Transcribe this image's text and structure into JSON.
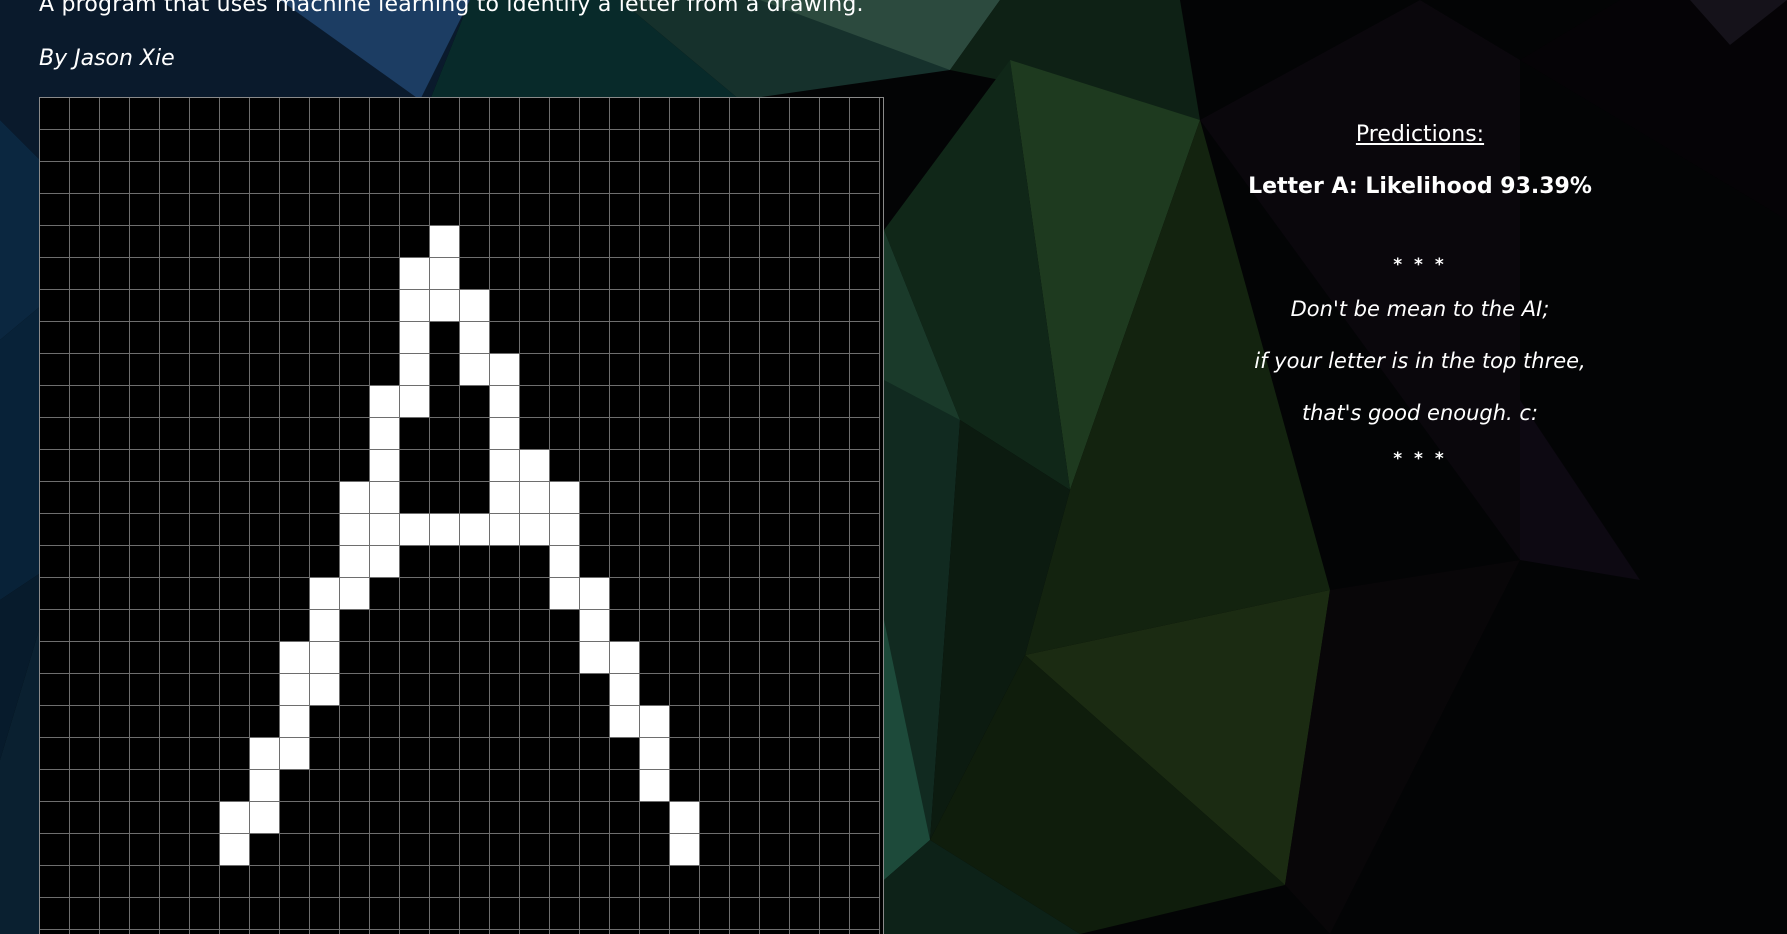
{
  "header": {
    "subtitle": "A program that uses machine learning to identify a letter from a drawing.",
    "byline": "By Jason Xie"
  },
  "drawing_grid": {
    "columns": 28,
    "visible_rows": 27,
    "filled_cells": [
      [
        4,
        13
      ],
      [
        5,
        12
      ],
      [
        5,
        13
      ],
      [
        6,
        12
      ],
      [
        6,
        13
      ],
      [
        6,
        14
      ],
      [
        7,
        12
      ],
      [
        7,
        14
      ],
      [
        8,
        12
      ],
      [
        8,
        14
      ],
      [
        8,
        15
      ],
      [
        9,
        11
      ],
      [
        9,
        12
      ],
      [
        9,
        15
      ],
      [
        10,
        11
      ],
      [
        10,
        15
      ],
      [
        11,
        11
      ],
      [
        11,
        15
      ],
      [
        11,
        16
      ],
      [
        12,
        10
      ],
      [
        12,
        11
      ],
      [
        12,
        15
      ],
      [
        12,
        16
      ],
      [
        12,
        17
      ],
      [
        13,
        10
      ],
      [
        13,
        11
      ],
      [
        13,
        12
      ],
      [
        13,
        13
      ],
      [
        13,
        14
      ],
      [
        13,
        15
      ],
      [
        13,
        16
      ],
      [
        13,
        17
      ],
      [
        14,
        10
      ],
      [
        14,
        11
      ],
      [
        14,
        17
      ],
      [
        15,
        9
      ],
      [
        15,
        10
      ],
      [
        15,
        17
      ],
      [
        15,
        18
      ],
      [
        16,
        9
      ],
      [
        16,
        18
      ],
      [
        17,
        8
      ],
      [
        17,
        9
      ],
      [
        17,
        18
      ],
      [
        17,
        19
      ],
      [
        18,
        8
      ],
      [
        18,
        9
      ],
      [
        18,
        19
      ],
      [
        19,
        8
      ],
      [
        19,
        19
      ],
      [
        19,
        20
      ],
      [
        20,
        7
      ],
      [
        20,
        8
      ],
      [
        20,
        20
      ],
      [
        21,
        7
      ],
      [
        21,
        20
      ],
      [
        22,
        6
      ],
      [
        22,
        7
      ],
      [
        22,
        21
      ],
      [
        23,
        6
      ],
      [
        23,
        21
      ]
    ],
    "on_color": "#ffffff",
    "off_color": "#000000",
    "line_color": "#6e6e6e"
  },
  "predictions": {
    "heading": "Predictions:",
    "result": "Letter A: Likelihood 93.39%",
    "separator_top": "* * *",
    "note_line_1": "Don't be mean to the AI;",
    "note_line_2": "if your letter is in the top three,",
    "note_line_3": "that's good enough. c:",
    "separator_bottom": "* * *"
  }
}
